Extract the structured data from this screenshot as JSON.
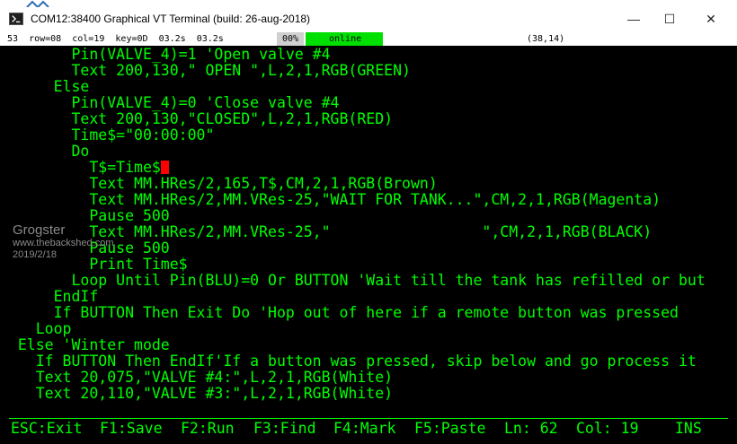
{
  "window": {
    "title": "COM12:38400  Graphical VT Terminal  (build: 26-aug-2018)",
    "min_symbol": "—",
    "max_symbol": "☐",
    "close_symbol": "✕"
  },
  "status": {
    "left": "53  row=08  col=19  key=0D  03.2s  03.2s",
    "zoom": "00%",
    "connection": "online",
    "position": "(38,14)"
  },
  "code_lines": [
    "        Pin(VALVE_4)=1 'Open valve #4",
    "        Text 200,130,\" OPEN \",L,2,1,RGB(GREEN)",
    "      Else",
    "        Pin(VALVE_4)=0 'Close valve #4",
    "        Text 200,130,\"CLOSED\",L,2,1,RGB(RED)",
    "        Time$=\"00:00:00\"",
    "        Do",
    "          T$=Time$",
    "          Text MM.HRes/2,165,T$,CM,2,1,RGB(Brown)",
    "          Text MM.HRes/2,MM.VRes-25,\"WAIT FOR TANK...\",CM,2,1,RGB(Magenta)",
    "          Pause 500",
    "          Text MM.HRes/2,MM.VRes-25,\"                 \",CM,2,1,RGB(BLACK)",
    "          Pause 500",
    "          Print Time$",
    "        Loop Until Pin(BLU)=0 Or BUTTON 'Wait till the tank has refilled or but",
    "      EndIf",
    "      If BUTTON Then Exit Do 'Hop out of here if a remote button was pressed",
    "    Loop",
    "  Else 'Winter mode",
    "    If BUTTON Then EndIf'If a button was pressed, skip below and go process it",
    "    Text 20,075,\"VALVE #4:\",L,2,1,RGB(White)",
    "    Text 20,110,\"VALVE #3:\",L,2,1,RGB(White)"
  ],
  "fkeys": [
    "ESC:Exit",
    "F1:Save",
    "F2:Run",
    "F3:Find",
    "F4:Mark",
    "F5:Paste",
    "Ln: 62",
    "Col: 19",
    "INS"
  ],
  "watermark": {
    "name": "Grogster",
    "site": "www.thebackshed.com",
    "date": "2019/2/18"
  },
  "colors": {
    "text": "#00ff00",
    "background": "#000000",
    "cursor": "#ff0000",
    "online": "#00e000"
  }
}
